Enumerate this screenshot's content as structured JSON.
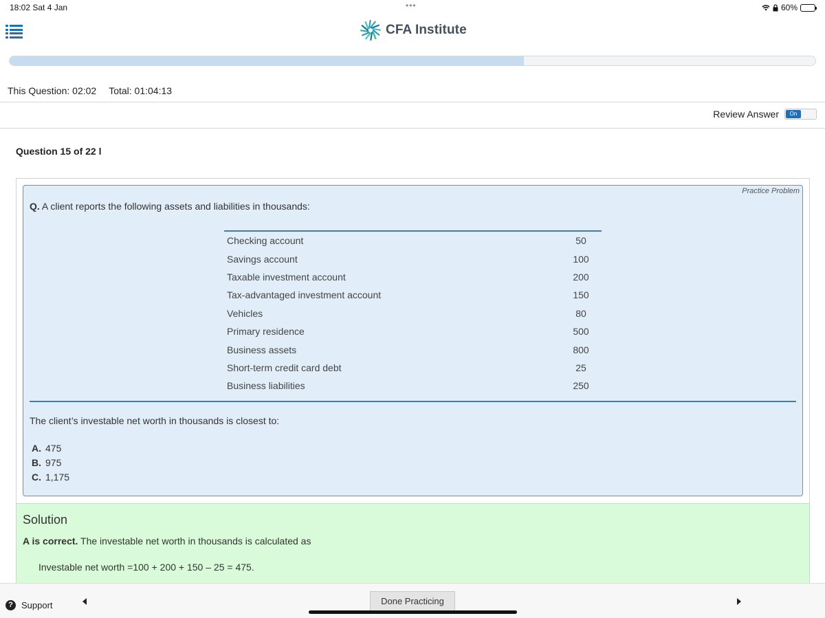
{
  "status_bar": {
    "time": "18:02  Sat 4 Jan",
    "dots": "•••",
    "battery": "60%",
    "battery_level": 0.6
  },
  "header": {
    "logo_text": "CFA Institute",
    "progress_fraction": 0.638
  },
  "timer": {
    "this_question": "This Question: 02:02",
    "total": "Total: 01:04:13"
  },
  "review": {
    "label": "Review Answer",
    "toggle": "On"
  },
  "question": {
    "number": "Question 15 of 22 l",
    "tag": "Practice Problem",
    "prefix": "Q.",
    "text": " A client reports the following assets and liabilities in thousands:",
    "table": [
      {
        "label": "Checking account",
        "value": "50"
      },
      {
        "label": "Savings account",
        "value": "100"
      },
      {
        "label": "Taxable investment account",
        "value": "200"
      },
      {
        "label": "Tax-advantaged investment account",
        "value": "150"
      },
      {
        "label": "Vehicles",
        "value": "80"
      },
      {
        "label": "Primary residence",
        "value": "500"
      },
      {
        "label": "Business assets",
        "value": "800"
      },
      {
        "label": "Short-term credit card debt",
        "value": "25"
      },
      {
        "label": "Business liabilities",
        "value": "250"
      }
    ],
    "stem": "The client’s investable net worth in thousands is closest to:",
    "choices": [
      {
        "letter": "A.",
        "text": "475"
      },
      {
        "letter": "B.",
        "text": "975"
      },
      {
        "letter": "C.",
        "text": "1,175"
      }
    ]
  },
  "solution": {
    "title": "Solution",
    "verdict": "A is correct.",
    "explanation": " The investable net worth in thousands is calculated as",
    "calculation": "Investable net worth =100 + 200 + 150 – 25 = 475."
  },
  "footer": {
    "support": "Support",
    "done": "Done Practicing"
  },
  "colors": {
    "accent": "#1f6fb8",
    "question_bg": "#e1edf8",
    "solution_bg": "#d9fbd9"
  }
}
